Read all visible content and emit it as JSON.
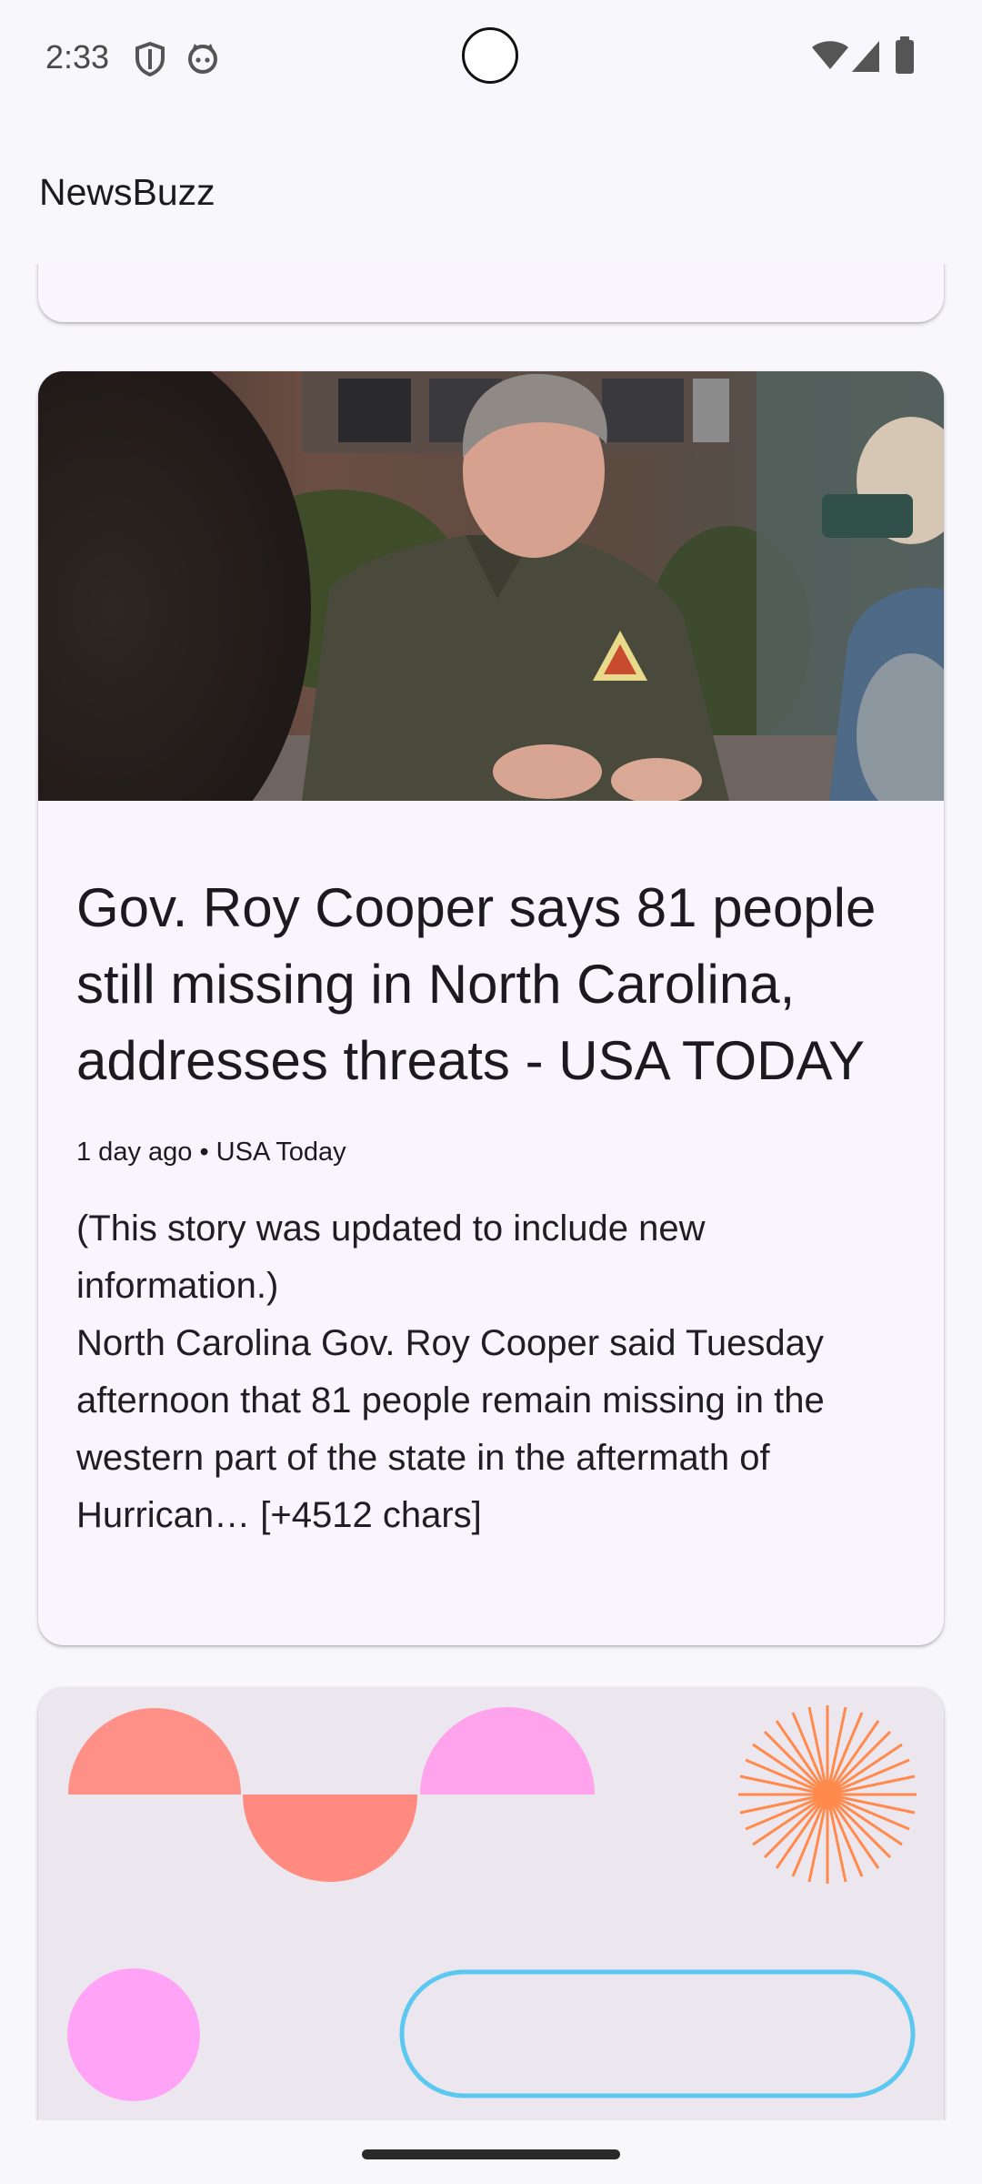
{
  "status_bar": {
    "time": "2:33",
    "left_icons": [
      "shield-icon",
      "cat-face-icon"
    ],
    "right_icons": [
      "wifi-icon",
      "cellular-signal-icon",
      "battery-icon"
    ]
  },
  "app_bar": {
    "title": "NewsBuzz"
  },
  "feed": {
    "articles": [
      {
        "image": "photo of a man in an olive work shirt talking outdoors, people with phones in foreground",
        "headline": "Gov. Roy Cooper says 81 people still missing in North Carolina, addresses threats - USA TODAY",
        "meta": "1 day ago • USA Today",
        "description": "(This story was updated to include new information.)\nNorth Carolina Gov. Roy Cooper said Tuesday afternoon that 81 people remain missing in the western part of the state in the aftermath of Hurrican… [+4512 chars]"
      },
      {
        "image": "abstract placeholder graphic"
      }
    ]
  },
  "colors": {
    "background": "#f8f7fb",
    "card": "#f8f6fc",
    "placeholder_bg": "#ece6ef",
    "coral": "#ff8a80",
    "pink": "#ffa3ec",
    "orange": "#ff8a4c",
    "blue_outline": "#5bc8f0"
  }
}
